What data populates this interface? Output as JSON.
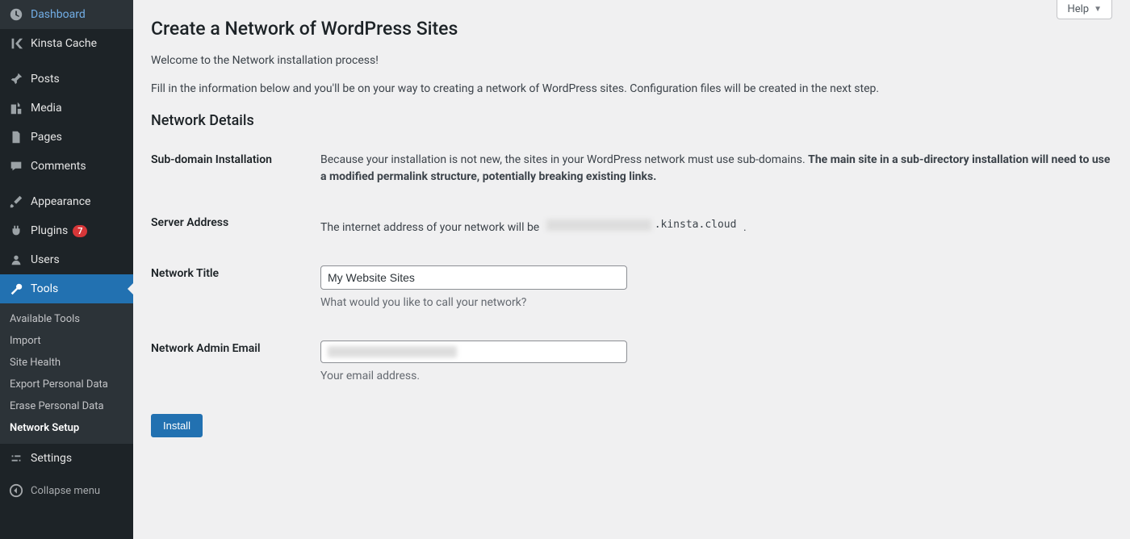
{
  "sidebar": {
    "dashboard": "Dashboard",
    "kinsta": "Kinsta Cache",
    "posts": "Posts",
    "media": "Media",
    "pages": "Pages",
    "comments": "Comments",
    "appearance": "Appearance",
    "plugins": "Plugins",
    "plugins_badge": "7",
    "users": "Users",
    "tools": "Tools",
    "tools_sub": {
      "available": "Available Tools",
      "import": "Import",
      "site_health": "Site Health",
      "export_personal": "Export Personal Data",
      "erase_personal": "Erase Personal Data",
      "network_setup": "Network Setup"
    },
    "settings": "Settings",
    "collapse": "Collapse menu"
  },
  "help": {
    "label": "Help"
  },
  "page": {
    "title": "Create a Network of WordPress Sites",
    "intro1": "Welcome to the Network installation process!",
    "intro2": "Fill in the information below and you'll be on your way to creating a network of WordPress sites. Configuration files will be created in the next step.",
    "section_title": "Network Details"
  },
  "form": {
    "subdomain_label": "Sub-domain Installation",
    "subdomain_text_a": "Because your installation is not new, the sites in your WordPress network must use sub-domains. ",
    "subdomain_text_b": "The main site in a sub-directory installation will need to use a modified permalink structure, potentially breaking existing links.",
    "server_label": "Server Address",
    "server_text": "The internet address of your network will be ",
    "server_code_visible": ".kinsta.cloud",
    "server_text_after": " .",
    "network_title_label": "Network Title",
    "network_title_value": "My Website Sites",
    "network_title_desc": "What would you like to call your network?",
    "email_label": "Network Admin Email",
    "email_desc": "Your email address.",
    "submit": "Install"
  }
}
